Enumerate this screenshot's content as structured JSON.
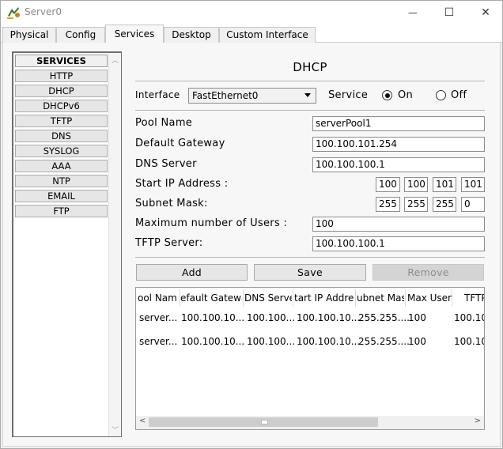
{
  "window": {
    "title": "Server0",
    "minimize": "—",
    "maximize": "☐",
    "close": "✕"
  },
  "tabs": [
    {
      "label": "Physical"
    },
    {
      "label": "Config"
    },
    {
      "label": "Services"
    },
    {
      "label": "Desktop"
    },
    {
      "label": "Custom Interface"
    }
  ],
  "services": {
    "header": "SERVICES",
    "items": [
      "HTTP",
      "DHCP",
      "DHCPv6",
      "TFTP",
      "DNS",
      "SYSLOG",
      "AAA",
      "NTP",
      "EMAIL",
      "FTP"
    ]
  },
  "dhcp": {
    "title": "DHCP",
    "interface_label": "Interface",
    "interface_value": "FastEthernet0",
    "service_label": "Service",
    "on_label": "On",
    "off_label": "Off",
    "service_state": "On",
    "fields": {
      "pool_name_label": "Pool Name",
      "pool_name": "serverPool1",
      "gateway_label": "Default Gateway",
      "gateway": "100.100.101.254",
      "dns_label": "DNS Server",
      "dns": "100.100.100.1",
      "start_ip_label": "Start IP Address :",
      "start_ip": [
        "100",
        "100",
        "101",
        "101"
      ],
      "mask_label": "Subnet Mask:",
      "mask": [
        "255",
        "255",
        "255",
        "0"
      ],
      "max_users_label": "Maximum number of Users :",
      "max_users": "100",
      "tftp_label": "TFTP Server:",
      "tftp": "100.100.100.1"
    },
    "buttons": {
      "add": "Add",
      "save": "Save",
      "remove": "Remove"
    },
    "table": {
      "headers": [
        "ool Nam",
        "efault Gatewa",
        "DNS Serve",
        "tart IP Addres",
        "ubnet Mas",
        "Max User",
        "TFTP"
      ],
      "rows": [
        [
          "server...",
          "100.100.10...",
          "100.100...",
          "100.100.10...",
          "255.255....",
          "100",
          "100.10"
        ],
        [
          "server...",
          "100.100.10...",
          "100.100...",
          "100.100.10...",
          "255.255....",
          "100",
          "100.10"
        ]
      ]
    }
  },
  "colors": {
    "window_bg": "#f0f0f0",
    "panel_bg": "#f7f7f7",
    "disabled_text": "#8d8d8d"
  }
}
